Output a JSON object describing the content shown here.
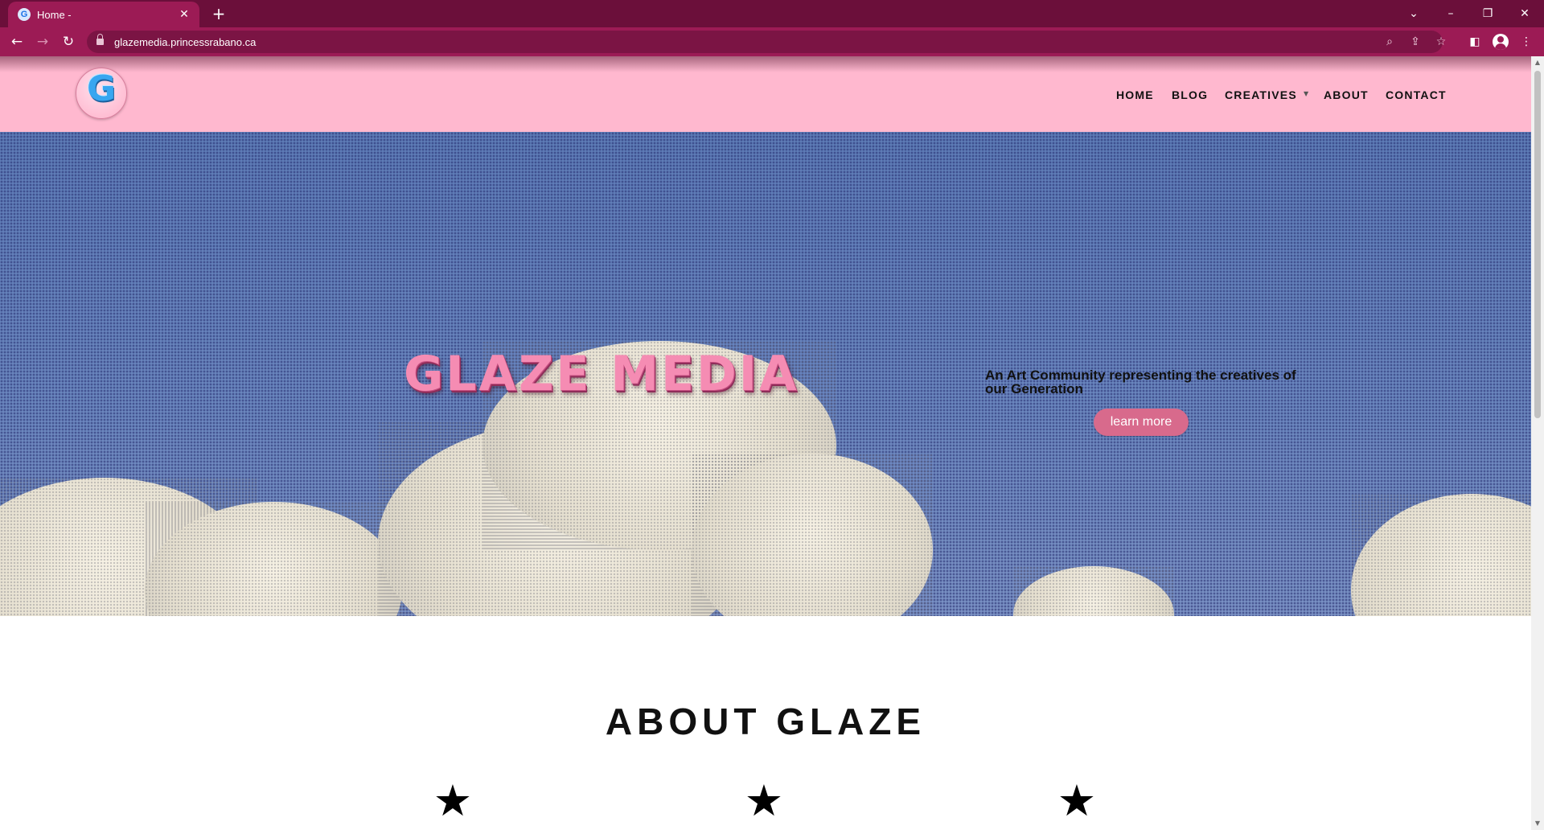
{
  "browser": {
    "tab_title": "Home -",
    "tab_favicon": "G",
    "url": "glazemedia.princessrabano.ca",
    "icons": {
      "close": "close-icon",
      "new_tab": "plus-icon",
      "back": "back-arrow-icon",
      "forward": "forward-arrow-icon",
      "reload": "reload-icon",
      "lock": "lock-icon",
      "zoom": "magnifier-icon",
      "share": "share-icon",
      "bookmark": "star-outline-icon",
      "side_panel": "side-panel-icon",
      "profile": "profile-avatar-icon",
      "menu": "kebab-menu-icon"
    }
  },
  "site": {
    "logo_letter": "G",
    "nav": [
      "HOME",
      "BLOG",
      "CREATIVES",
      "ABOUT",
      "CONTACT"
    ],
    "hero": {
      "title": "GLAZE MEDIA",
      "tagline": "An Art Community representing the creatives of our Generation",
      "button": "learn more"
    },
    "about_title": "ABOUT GLAZE",
    "stars": [
      "★",
      "★",
      "★"
    ]
  },
  "colors": {
    "tab_bar": "#6b0f3a",
    "toolbar": "#9c1b55",
    "header_pink": "#ffb8cf",
    "hero_title_pink": "#f58cb3",
    "button_pink": "#d86a8c",
    "sky_blue": "#5d7bb6"
  }
}
